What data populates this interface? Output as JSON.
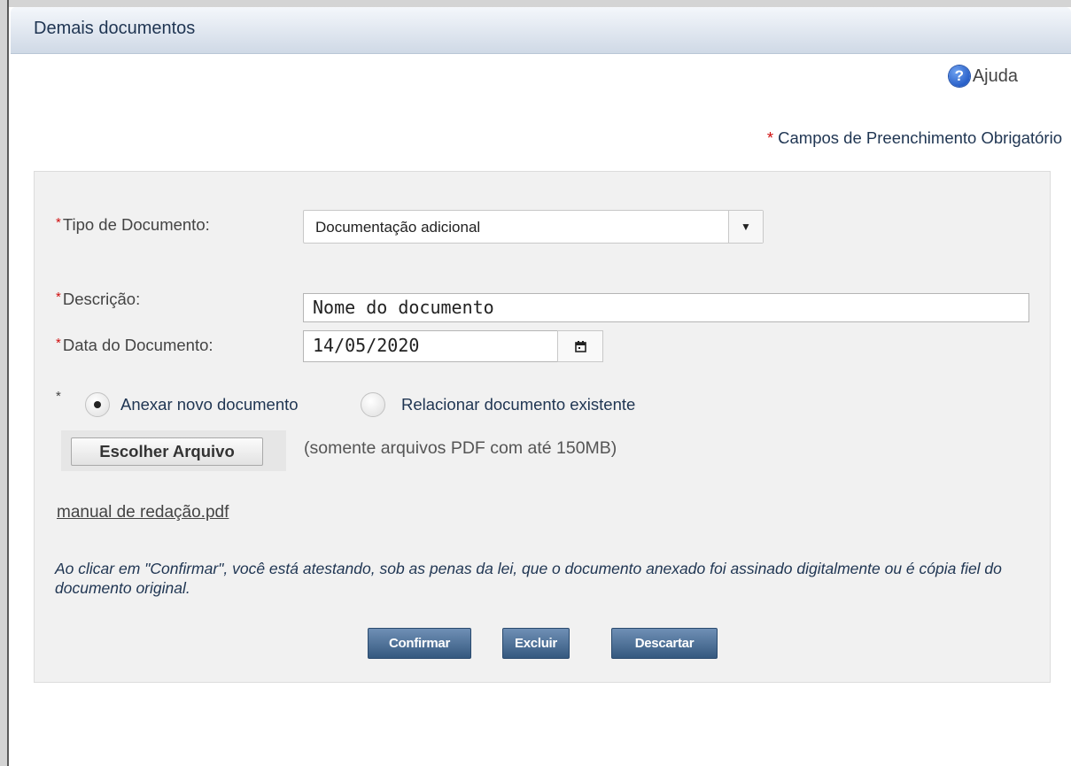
{
  "dialog": {
    "title": "Demais documentos",
    "help_label": "Ajuda",
    "required_asterisk": "*",
    "required_note": "Campos de Preenchimento Obrigatório"
  },
  "form": {
    "tipo_label": "Tipo de Documento:",
    "tipo_value": "Documentação adicional",
    "descricao_label": "Descrição:",
    "descricao_value": "Nome do documento",
    "data_label": "Data do Documento:",
    "data_value": "14/05/2020",
    "attach_options": [
      {
        "label": "Anexar novo documento",
        "selected": true
      },
      {
        "label": "Relacionar documento existente",
        "selected": false
      }
    ],
    "file_button": "Escolher Arquivo",
    "file_hint": "(somente arquivos PDF com até 150MB)",
    "file_name": "manual de redação.pdf",
    "disclaimer": "Ao clicar em \"Confirmar\", você está atestando, sob as penas da lei, que o documento anexado foi assinado digitalmente ou é cópia fiel do documento original."
  },
  "actions": {
    "confirm": "Confirmar",
    "delete": "Excluir",
    "discard": "Descartar"
  },
  "icons": {
    "help": "help-circle-icon",
    "dropdown": "caret-down-icon",
    "calendar": "calendar-icon"
  },
  "colors": {
    "required": "#d01010",
    "primary_button": "#4a6d94",
    "title_text": "#1f3552"
  }
}
